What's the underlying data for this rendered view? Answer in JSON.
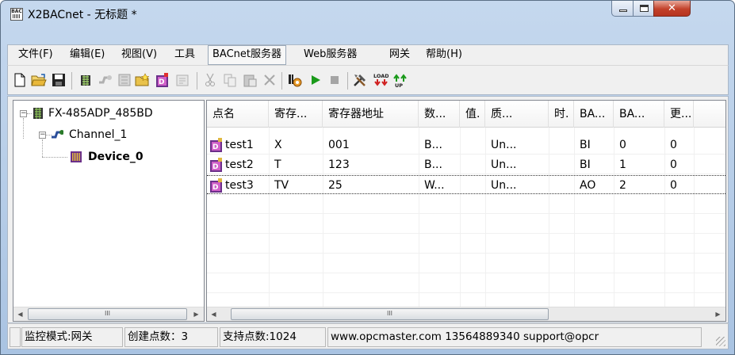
{
  "window": {
    "title": "X2BACnet - 无标题 *"
  },
  "menu": [
    {
      "label": "文件(F)"
    },
    {
      "label": "编辑(E)"
    },
    {
      "label": "视图(V)"
    },
    {
      "label": "工具"
    },
    {
      "label": "BACnet服务器"
    },
    {
      "label": "Web服务器"
    },
    {
      "label": "网关"
    },
    {
      "label": "帮助(H)"
    }
  ],
  "toolbar": {
    "buttons": [
      {
        "icon": "new-file-icon"
      },
      {
        "icon": "open-folder-icon"
      },
      {
        "icon": "save-icon"
      },
      {
        "icon": "device-add-icon"
      },
      {
        "icon": "channel-icon"
      },
      {
        "icon": "device-icon"
      },
      {
        "icon": "add-point-icon"
      },
      {
        "icon": "bacnet-point-icon"
      },
      {
        "icon": "properties-icon"
      },
      {
        "icon": "cut-icon"
      },
      {
        "icon": "copy-icon"
      },
      {
        "icon": "paste-icon"
      },
      {
        "icon": "delete-icon"
      },
      {
        "icon": "run-config-icon"
      },
      {
        "icon": "start-icon"
      },
      {
        "icon": "stop-icon"
      },
      {
        "icon": "tools-icon"
      },
      {
        "icon": "load-icon"
      },
      {
        "icon": "upload-icon"
      }
    ],
    "load_text": "LOAD",
    "up_text": "UP"
  },
  "tree": {
    "root": "FX-485ADP_485BD",
    "channel": "Channel_1",
    "device": "Device_0"
  },
  "list": {
    "columns": [
      "点名",
      "寄存...",
      "寄存器地址",
      "数...",
      "值.",
      "质...",
      "时.",
      "BA...",
      "BA...",
      "更..."
    ],
    "rows": [
      [
        "test1",
        "X",
        "001",
        "B...",
        "",
        "Un...",
        "",
        "BI",
        "0",
        "0"
      ],
      [
        "test2",
        "T",
        "123",
        "B...",
        "",
        "Un...",
        "",
        "BI",
        "1",
        "0"
      ],
      [
        "test3",
        "TV",
        "25",
        "W...",
        "",
        "Un...",
        "",
        "AO",
        "2",
        "0"
      ]
    ]
  },
  "scroll": {
    "thumb_glyph": "III"
  },
  "status": {
    "lead": "",
    "mode": "监控模式:网关",
    "count": "创建点数：3",
    "support": "支持点数:1024",
    "info": "www.opcmaster.com 13564889340 support@opcr"
  },
  "colors": {
    "caption": "#c5d8ee",
    "close": "#c2412a",
    "start": "#1a9a1a",
    "device": "#7a3a8a"
  }
}
